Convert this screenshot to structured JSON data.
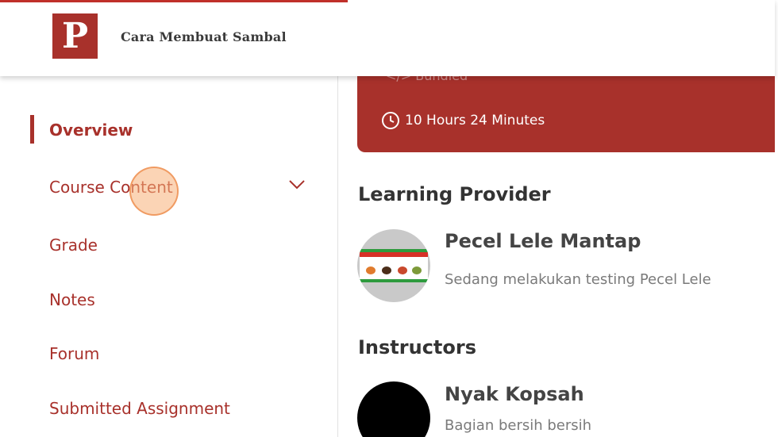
{
  "header": {
    "logo_letter": "P",
    "title": "Cara Membuat Sambal"
  },
  "sidebar": {
    "items": [
      {
        "label": "Overview",
        "active": true
      },
      {
        "label": "Course Content",
        "expandable": true
      },
      {
        "label": "Grade"
      },
      {
        "label": "Notes"
      },
      {
        "label": "Forum"
      },
      {
        "label": "Submitted Assignment"
      }
    ]
  },
  "banner": {
    "meta_partial": "Bundled",
    "duration": "10 Hours 24 Minutes"
  },
  "provider": {
    "heading": "Learning Provider",
    "name": "Pecel Lele Mantap",
    "description": "Sedang melakukan testing Pecel Lele"
  },
  "instructors": {
    "heading": "Instructors",
    "items": [
      {
        "name": "Nyak Kopsah",
        "description": "Bagian bersih bersih"
      }
    ]
  },
  "colors": {
    "brand": "#a8312b",
    "heading_text": "#333333",
    "muted_text": "#7a7a7a"
  },
  "icons": {
    "clock": "clock-icon",
    "chevron": "chevron-down-icon",
    "bundle": "code-icon"
  }
}
